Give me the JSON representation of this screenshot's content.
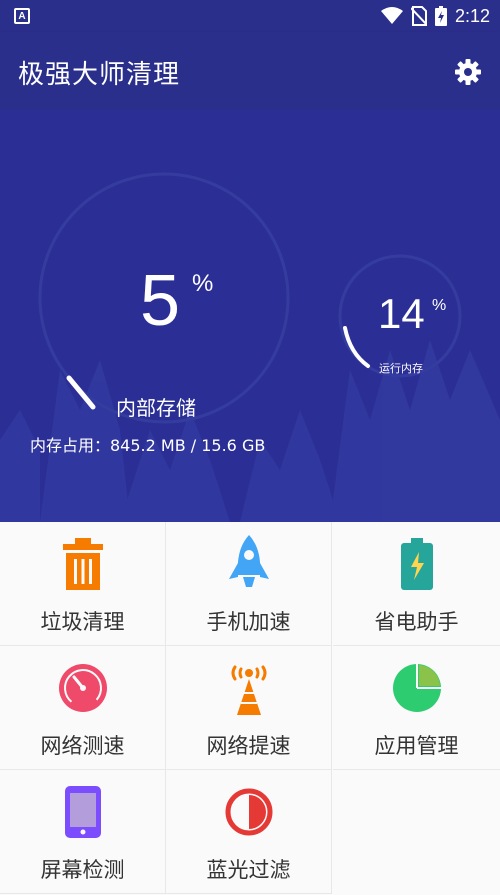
{
  "status_bar": {
    "left_icon": "A",
    "time": "2:12",
    "icons": [
      "wifi-icon",
      "no-sim-icon",
      "battery-charging-icon"
    ]
  },
  "toolbar": {
    "title": "极强大师清理",
    "settings_icon": "gear-icon"
  },
  "storage": {
    "percent": "5",
    "percent_sign": "%",
    "label": "内部存储",
    "usage_text": "内存占用：845.2 MB / 15.6 GB"
  },
  "ram": {
    "percent": "14",
    "percent_sign": "%",
    "label": "运行内存"
  },
  "tools": [
    {
      "label": "垃圾清理",
      "icon": "trash-icon"
    },
    {
      "label": "手机加速",
      "icon": "rocket-icon"
    },
    {
      "label": "省电助手",
      "icon": "battery-icon"
    },
    {
      "label": "网络测速",
      "icon": "speedometer-icon"
    },
    {
      "label": "网络提速",
      "icon": "signal-tower-icon"
    },
    {
      "label": "应用管理",
      "icon": "pie-chart-icon"
    },
    {
      "label": "屏幕检测",
      "icon": "phone-screen-icon"
    },
    {
      "label": "蓝光过滤",
      "icon": "half-circle-icon"
    }
  ],
  "colors": {
    "primary": "#2b2f8c",
    "hero_bg": "#2b2f95",
    "orange": "#f57c00",
    "blue": "#42a5f5",
    "teal": "#26a69a",
    "pink": "#ef4a6a",
    "green": "#2ecc71",
    "purple": "#7c4dff",
    "red": "#e53935"
  }
}
